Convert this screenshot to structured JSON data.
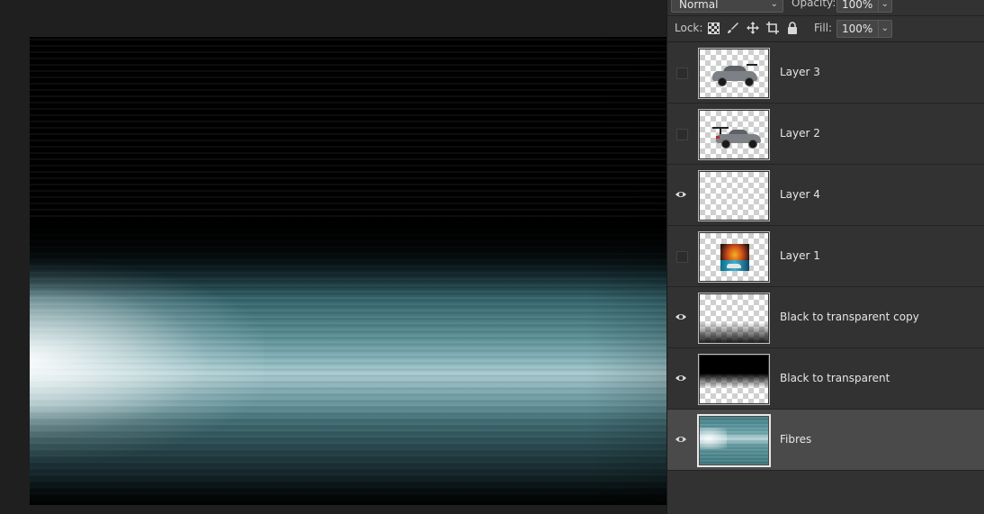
{
  "panel": {
    "blend_mode": "Normal",
    "opacity_label": "Opacity:",
    "opacity_value": "100%",
    "lock_label": "Lock:",
    "fill_label": "Fill:",
    "fill_value": "100%"
  },
  "layers": [
    {
      "name": "Layer 3",
      "visible": false,
      "thumb": "car-gray"
    },
    {
      "name": "Layer 2",
      "visible": false,
      "thumb": "car-wing"
    },
    {
      "name": "Layer 4",
      "visible": true,
      "thumb": "transparent"
    },
    {
      "name": "Layer 1",
      "visible": false,
      "thumb": "fire-car"
    },
    {
      "name": "Black to transparent copy",
      "visible": true,
      "thumb": "bottom-black-gradient"
    },
    {
      "name": "Black to transparent",
      "visible": true,
      "thumb": "top-black-gradient"
    },
    {
      "name": "Fibres",
      "visible": true,
      "thumb": "fibres",
      "selected": true
    }
  ],
  "colors": {
    "panel_bg": "#323232",
    "selected_bg": "#4a4a4a",
    "workspace_bg": "#1f1f1f"
  }
}
